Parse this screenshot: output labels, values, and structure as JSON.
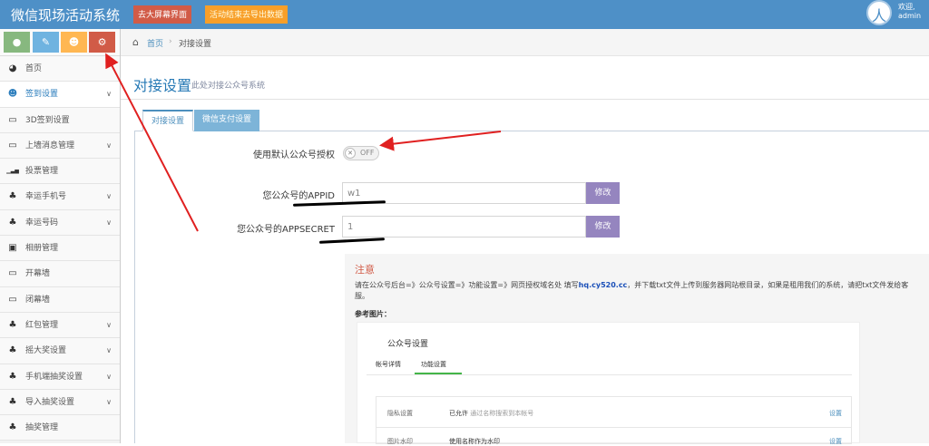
{
  "header": {
    "app_title": "微信现场活动系统",
    "bigscreen_button": "去大屏幕界面",
    "export_button": "活动结束去导出数据",
    "welcome_line1": "欢迎,",
    "welcome_line2": "admin",
    "avatar_glyph": "人"
  },
  "shortcuts": [
    {
      "icon": "chat-icon",
      "glyph": "●",
      "color": "#87b87f"
    },
    {
      "icon": "pencil-icon",
      "glyph": "✎",
      "color": "#6fb3e0"
    },
    {
      "icon": "users-icon",
      "glyph": "☻",
      "color": "#ffb752"
    },
    {
      "icon": "gears-icon",
      "glyph": "⚙",
      "color": "#d15b47"
    }
  ],
  "sidebar": {
    "items": [
      {
        "label": "首页",
        "icon": "dashboard-icon",
        "glyph": "◕",
        "chevron": false,
        "active": false
      },
      {
        "label": "签到设置",
        "icon": "users-icon",
        "glyph": "☻",
        "chevron": true,
        "active": true
      },
      {
        "label": "3D签到设置",
        "icon": "desktop-icon",
        "glyph": "▭",
        "chevron": false,
        "active": false
      },
      {
        "label": "上墙消息管理",
        "icon": "desktop-icon",
        "glyph": "▭",
        "chevron": true,
        "active": false
      },
      {
        "label": "投票管理",
        "icon": "signal-icon",
        "glyph": "▁▃▅",
        "chevron": false,
        "active": false
      },
      {
        "label": "幸运手机号",
        "icon": "gift-icon",
        "glyph": "♣",
        "chevron": true,
        "active": false
      },
      {
        "label": "幸运号码",
        "icon": "gift-icon",
        "glyph": "♣",
        "chevron": true,
        "active": false
      },
      {
        "label": "相册管理",
        "icon": "picture-icon",
        "glyph": "▣",
        "chevron": false,
        "active": false
      },
      {
        "label": "开幕墙",
        "icon": "desktop-icon",
        "glyph": "▭",
        "chevron": false,
        "active": false
      },
      {
        "label": "闭幕墙",
        "icon": "desktop-icon",
        "glyph": "▭",
        "chevron": false,
        "active": false
      },
      {
        "label": "红包管理",
        "icon": "gift-icon",
        "glyph": "♣",
        "chevron": true,
        "active": false
      },
      {
        "label": "摇大奖设置",
        "icon": "gift-icon",
        "glyph": "♣",
        "chevron": true,
        "active": false
      },
      {
        "label": "手机端抽奖设置",
        "icon": "gift-icon",
        "glyph": "♣",
        "chevron": true,
        "active": false
      },
      {
        "label": "导入抽奖设置",
        "icon": "gift-icon",
        "glyph": "♣",
        "chevron": true,
        "active": false
      },
      {
        "label": "抽奖管理",
        "icon": "gift-icon",
        "glyph": "♣",
        "chevron": false,
        "active": false
      }
    ]
  },
  "breadcrumb": {
    "home": "首页",
    "separator": "›",
    "current": "对接设置"
  },
  "page": {
    "title": "对接设置",
    "subtitle": "此处对接公众号系统"
  },
  "tabs": {
    "integration": "对接设置",
    "payment": "微信支付设置"
  },
  "form": {
    "default_auth_label": "使用默认公众号授权",
    "toggle_state": "OFF",
    "toggle_knob": "✕",
    "appid_label": "您公众号的APPID",
    "appid_value": "w1",
    "secret_label": "您公众号的APPSECRET",
    "secret_value": "1",
    "edit_label": "修改"
  },
  "notice": {
    "title": "注意",
    "text_before": "请在公众号后台=》公众号设置=》功能设置=》网页授权域名处 填写",
    "domain": "hq.cy520.cc",
    "text_after": "，并下载txt文件上传到服务器网站根目录，如果是租用我们的系统，请把txt文件发给客服。",
    "ref_label": "参考图片：",
    "ref": {
      "title": "公众号设置",
      "tab1": "帐号详情",
      "tab2": "功能设置",
      "rows": [
        {
          "name": "隐私设置",
          "value": "已允许",
          "note": " 通过名称搜索到本帐号",
          "action": "设置"
        },
        {
          "name": "图片水印",
          "value": "使用名称作为水印",
          "note": "",
          "action": "设置"
        }
      ]
    }
  },
  "annotation_color": "#e02020"
}
